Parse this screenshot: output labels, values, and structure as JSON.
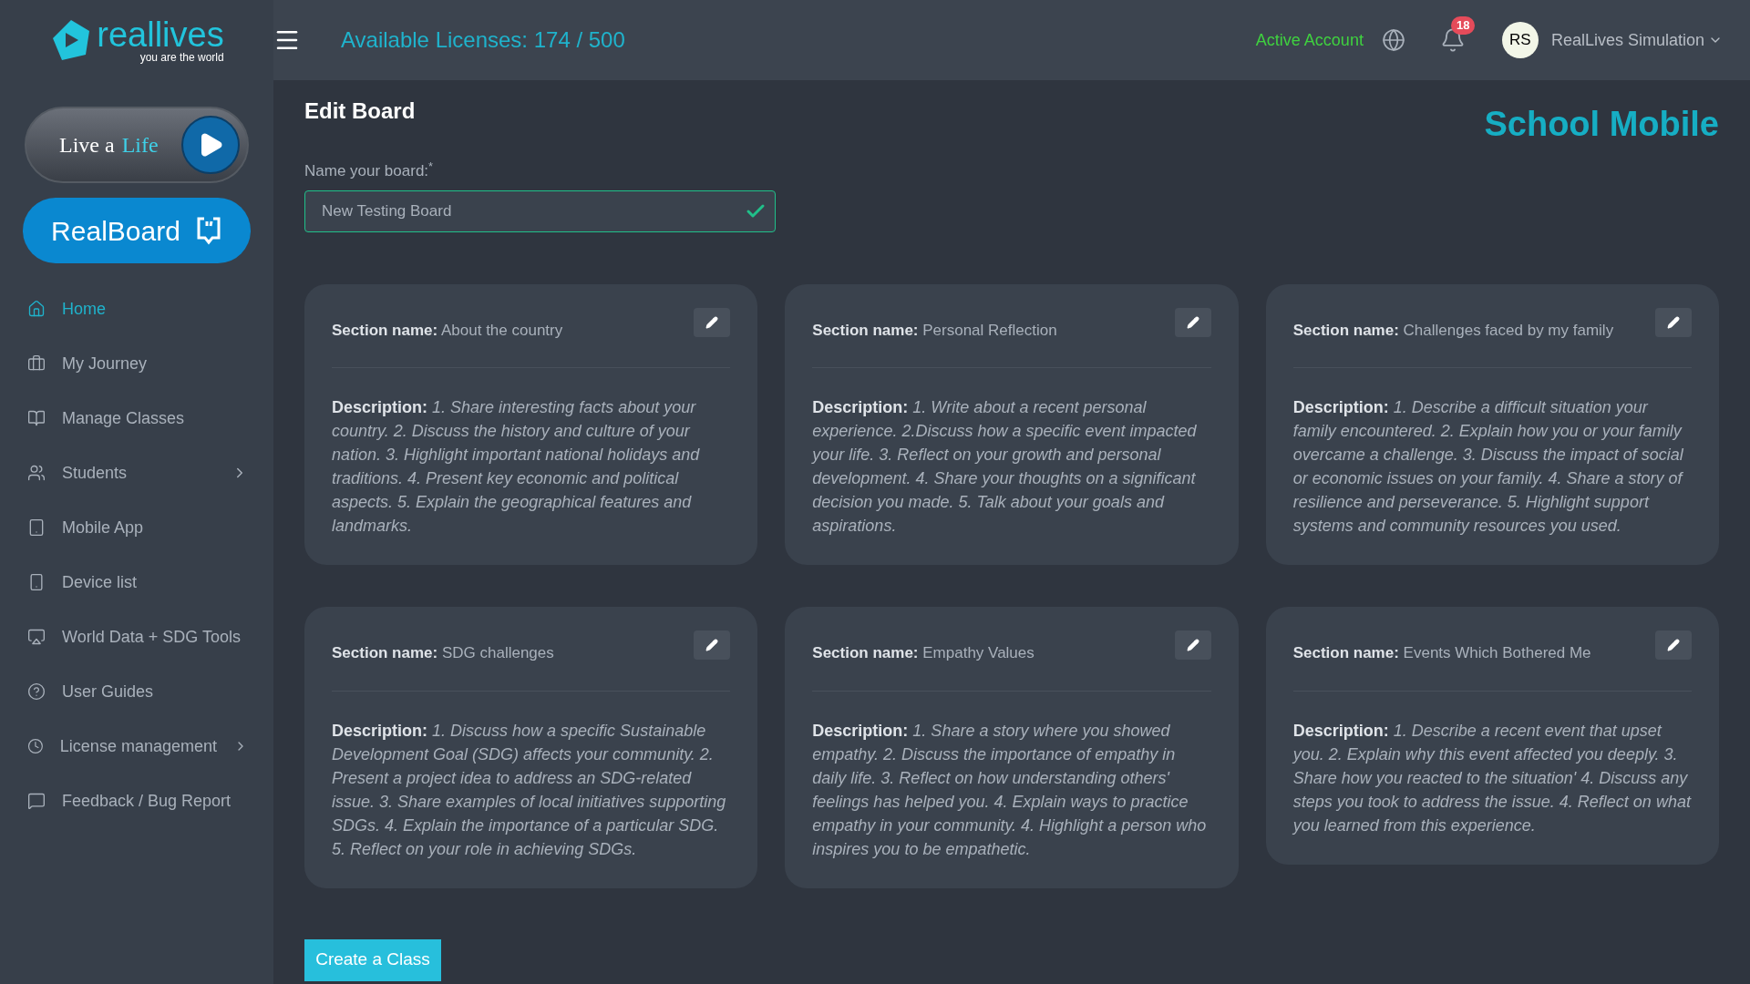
{
  "logo": {
    "name": "reallives",
    "tagline": "you are the world"
  },
  "sidebar": {
    "live_button": {
      "text": "Live a",
      "highlight": "Life"
    },
    "realboard_button": "RealBoard",
    "items": [
      {
        "label": "Home",
        "selected": true,
        "has_submenu": false
      },
      {
        "label": "My Journey",
        "selected": false,
        "has_submenu": false
      },
      {
        "label": "Manage Classes",
        "selected": false,
        "has_submenu": false
      },
      {
        "label": "Students",
        "selected": false,
        "has_submenu": true
      },
      {
        "label": "Mobile App",
        "selected": false,
        "has_submenu": false
      },
      {
        "label": "Device list",
        "selected": false,
        "has_submenu": false
      },
      {
        "label": "World Data + SDG Tools",
        "selected": false,
        "has_submenu": false
      },
      {
        "label": "User Guides",
        "selected": false,
        "has_submenu": false
      },
      {
        "label": "License management",
        "selected": false,
        "has_submenu": true
      },
      {
        "label": "Feedback / Bug Report",
        "selected": false,
        "has_submenu": false
      }
    ]
  },
  "header": {
    "licenses": "Available Licenses: 174 / 500",
    "account_status": "Active Account",
    "notification_count": "18",
    "avatar_initials": "RS",
    "user_name": "RealLives Simulation"
  },
  "page": {
    "title": "Edit Board",
    "school": "School Mobile",
    "board_name_label": "Name your board:",
    "required_mark": "*",
    "board_name_value": "New Testing Board",
    "board_name_valid": true,
    "sections": [
      {
        "name": "**Section name:** About the country",
        "description": "**Description:** *1. Share interesting facts about your country. 2. Discuss the history and culture of your nation. 3. Highlight important national holidays and traditions. 4. Present key economic and political aspects. 5. Explain the geographical features and landmarks.*"
      },
      {
        "name": "**Section name:** Personal Reflection",
        "description": "**Description:** *1. Write about a recent personal experience. 2.Discuss how a specific event impacted your life. 3. Reflect on your growth and personal development. 4. Share your thoughts on a significant decision you made. 5. Talk about your goals and aspirations.*"
      },
      {
        "name": "**Section name:** Challenges faced by my family",
        "description": "**Description:** *1. Describe a difficult situation your family encountered. 2. Explain how you or your family overcame a challenge. 3. Discuss the impact of social or economic issues on your family. 4. Share a story of resilience and perseverance. 5. Highlight support systems and community resources you used.*"
      },
      {
        "name": "**Section name:** SDG challenges",
        "description": "**Description:** *1. Discuss how a specific Sustainable Development Goal (SDG) affects your community. 2. Present a project idea to address an SDG-related issue. 3. Share examples of local initiatives supporting SDGs. 4. Explain the importance of a particular SDG. 5. Reflect on your role in achieving SDGs.*"
      },
      {
        "name": "**Section name:** Empathy Values",
        "description": "**Description:** *1. Share a story where you showed empathy. 2. Discuss the importance of empathy in daily life. 3. Reflect on how understanding others' feelings has helped you. 4. Explain ways to practice empathy in your community. 4. Highlight a person who inspires you to be empathetic.*"
      },
      {
        "name": "**Section name:** Events Which Bothered Me",
        "description": "**Description:** *1. Describe a recent event that upset you. 2. Explain why this event affected you deeply. 3. Share how you reacted to the situation' 4. Discuss any steps you took to address the issue. 4. Reflect on what you learned from this experience.*"
      }
    ],
    "create_button": "Create a Class"
  }
}
